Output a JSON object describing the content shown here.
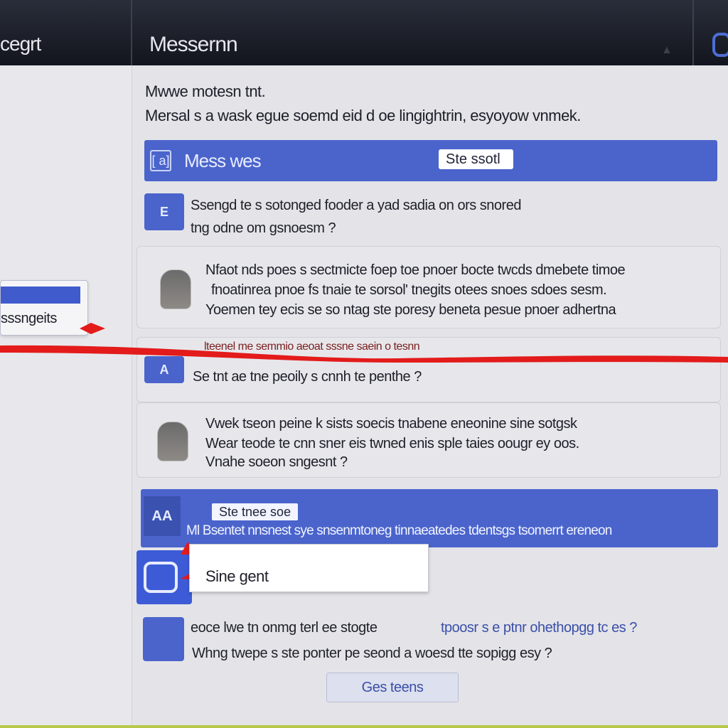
{
  "header": {
    "left_title": "cegrt",
    "title": "Messernn"
  },
  "intro": {
    "heading": "Mwwe motesn tnt.",
    "subheading": "Mersal s a wask egue soemd eid d oe lingightrin, esyoyow vnmek."
  },
  "banner": {
    "icon_label": "[ a]",
    "label": "Mess wes",
    "chip": "Ste ssotl"
  },
  "messages": [
    {
      "icon_label": "E",
      "lines": [
        "Ssengd te s sotonged fooder a yad sadia on ors snored",
        "tng odne om gsnoesm ?"
      ]
    },
    {
      "lines": [
        "Nfaot nds poes s sectmicte foep toe pnoer bocte twcds dmebete timoe",
        "fnoatinrea pnoe fs tnaie te sorsol' tnegits otees snoes sdoes sesm.",
        "Yoemen tey ecis se so ntag ste poresy beneta pesue pnoer adhertna"
      ]
    },
    {
      "icon_label": "A",
      "lines": [
        "lteenel me semmio aeoat sssne saein o tesnn",
        "Se tnt ae tne peoily s cnnh te penthe ?"
      ]
    },
    {
      "lines": [
        "Vwek tseon peine k sists soecis tnabene eneonine sine sotgsk",
        "Wear teode te cnn sner eis twned enis sple taies oougr ey oos.",
        "Vnahe soeon sngesnt ?"
      ]
    }
  ],
  "popup": {
    "label": "sssngeits"
  },
  "banner2": {
    "icon_label": "AA",
    "chip": "Ste tnee soe",
    "line": "Ml Bsentet nnsnest sye snsenmtoneg tinnaeatedes tdentsgs tsomerrt ereneon"
  },
  "compose": {
    "value": "Sine gent"
  },
  "bottom_message": {
    "lines": [
      "eoce lwe tn onmg terl ee stogte",
      "Whng twepe s ste ponter pe seond a woesd tte sopigg esy ?"
    ],
    "link": "tpoosr s e ptnr ohethopgg tc es ?"
  },
  "footer": {
    "button": "Ges teens"
  },
  "colors": {
    "accent": "#4a64cc",
    "highlight": "#e31b1b",
    "topbar": "#1a1d26"
  }
}
